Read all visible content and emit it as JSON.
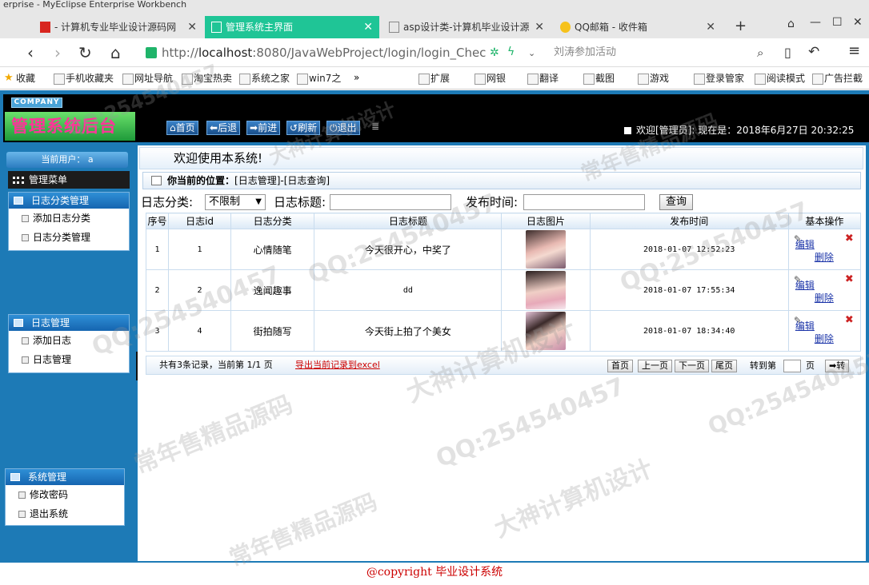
{
  "browser": {
    "window_title_fragment": "erprise - MyEclipse Enterprise Workbench",
    "tabs": [
      {
        "label": "- 计算机专业毕业设计源码网",
        "active": false
      },
      {
        "label": "管理系统主界面",
        "active": true
      },
      {
        "label": "asp设计类-计算机毕业设计源",
        "active": false
      },
      {
        "label": "QQ邮箱 - 收件箱",
        "active": false
      }
    ],
    "url_scheme": "http://",
    "url_host": "localhost",
    "url_rest": ":8080/JavaWebProject/login/login_Chec",
    "news": "刘涛参加活动",
    "bookmarks": [
      "收藏",
      "手机收藏夹",
      "网址导航",
      "淘宝热卖",
      "系统之家",
      "win7之",
      "»",
      "扩展",
      "网银",
      "翻译",
      "截图",
      "游戏",
      "登录管家",
      "阅读模式",
      "广告拦截"
    ]
  },
  "header": {
    "company": "COMPANY",
    "title": "管理系统后台",
    "toolbar": [
      "首页",
      "后退",
      "前进",
      "刷新",
      "退出"
    ],
    "welcome": "欢迎[管理员]:  现在是：2018年6月27日 20:32:25"
  },
  "sidebar": {
    "current_user": "当前用户： a",
    "menu_title": "管理菜单",
    "panels": [
      {
        "title": "日志分类管理",
        "items": [
          "添加日志分类",
          "日志分类管理"
        ]
      },
      {
        "title": "日志管理",
        "items": [
          "添加日志",
          "日志管理"
        ]
      },
      {
        "title": "系统管理",
        "items": [
          "修改密码",
          "退出系统"
        ]
      }
    ]
  },
  "main": {
    "welcome": "欢迎使用本系统!",
    "location_label": "你当前的位置：",
    "location_path": "[日志管理]-[日志查询]",
    "search": {
      "category_label": "日志分类:",
      "category_value": "不限制",
      "title_label": "日志标题:",
      "time_label": "发布时间:",
      "query_button": "查询"
    },
    "table": {
      "headers": [
        "序号",
        "日志id",
        "日志分类",
        "日志标题",
        "日志图片",
        "发布时间",
        "基本操作"
      ],
      "rows": [
        {
          "no": "1",
          "id": "1",
          "category": "心情随笔",
          "title": "今天很开心，中奖了",
          "time": "2018-01-07 12:52:23"
        },
        {
          "no": "2",
          "id": "2",
          "category": "逸闻趣事",
          "title": "dd",
          "time": "2018-01-07 17:55:34"
        },
        {
          "no": "3",
          "id": "4",
          "category": "街拍随写",
          "title": "今天街上拍了个美女",
          "time": "2018-01-07 18:34:40"
        }
      ],
      "edit_label": "编辑",
      "delete_label": "删除"
    },
    "pager": {
      "summary": "共有3条记录，当前第 1/1 页",
      "export": "导出当前记录到excel",
      "first": "首页",
      "prev": "上一页",
      "next": "下一页",
      "last": "尾页",
      "goto_label": "转到第",
      "page_unit": "页",
      "go": "转"
    }
  },
  "footer": {
    "prefix": "@copyright ",
    "text": "毕业设计系统"
  },
  "watermarks": [
    "QQ:254540457",
    "常年售精品源码",
    "大神计算机设计"
  ]
}
